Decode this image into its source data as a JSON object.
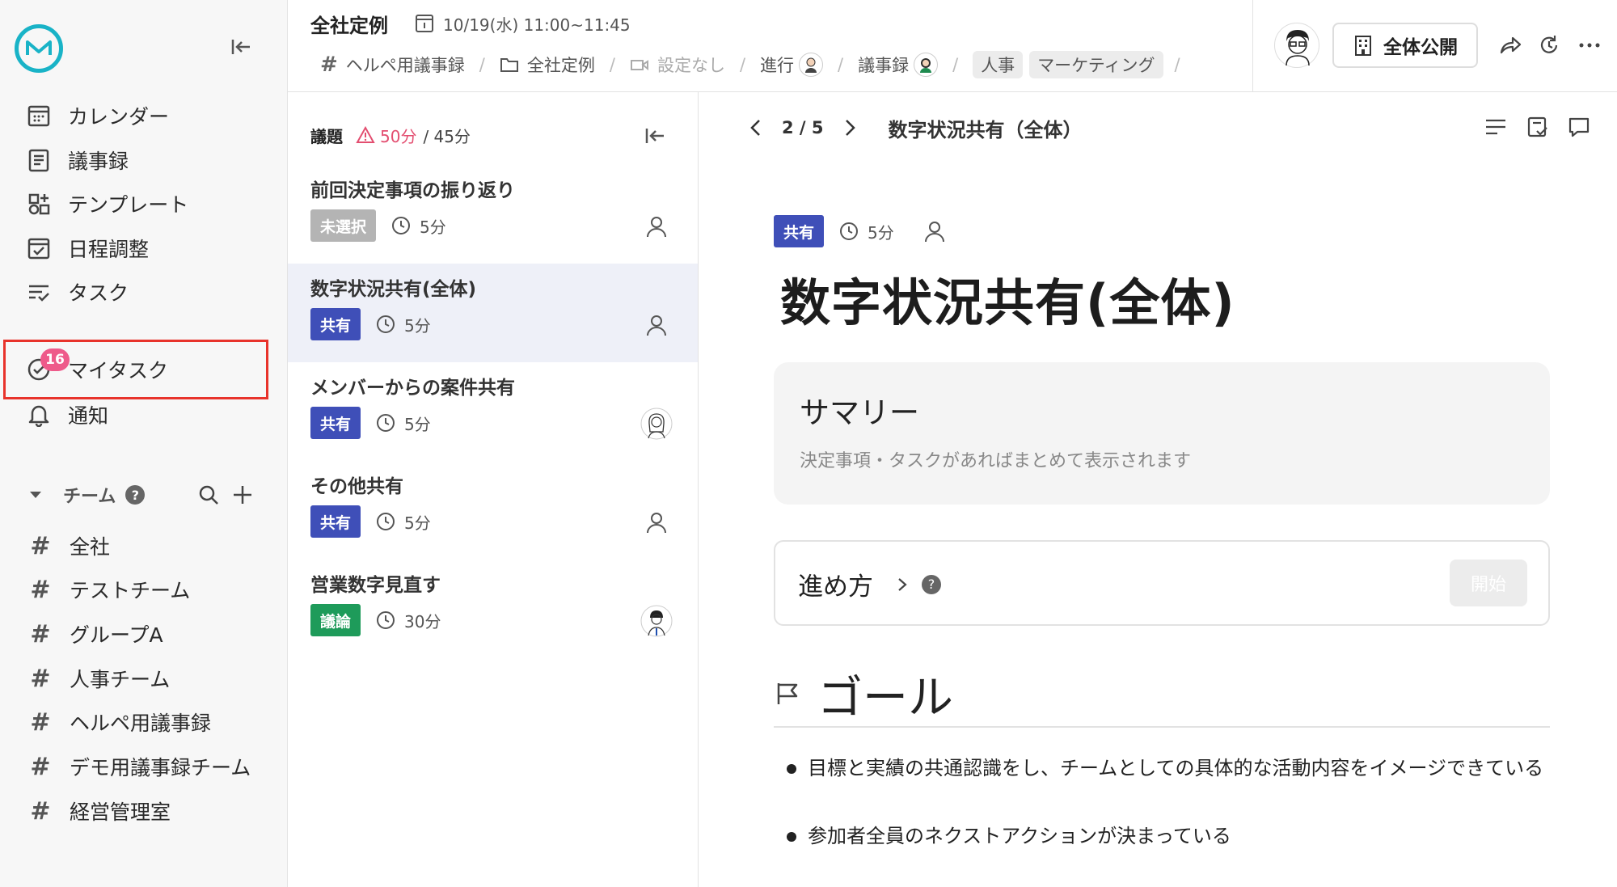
{
  "sidebar": {
    "nav": [
      {
        "label": "カレンダー",
        "icon": "calendar-icon"
      },
      {
        "label": "議事録",
        "icon": "document-icon"
      },
      {
        "label": "テンプレート",
        "icon": "template-icon"
      },
      {
        "label": "日程調整",
        "icon": "schedule-icon"
      },
      {
        "label": "タスク",
        "icon": "task-list-icon"
      },
      {
        "label": "マイタスク",
        "icon": "my-task-icon",
        "badge": "16"
      },
      {
        "label": "通知",
        "icon": "bell-icon"
      }
    ],
    "team_header": "チーム",
    "teams": [
      {
        "label": "全社",
        "locked": false
      },
      {
        "label": "テストチーム",
        "locked": false
      },
      {
        "label": "グループA",
        "locked": true
      },
      {
        "label": "人事チーム",
        "locked": true
      },
      {
        "label": "ヘルペ用議事録",
        "locked": false
      },
      {
        "label": "デモ用議事録チーム",
        "locked": false
      },
      {
        "label": "経営管理室",
        "locked": false
      }
    ]
  },
  "header": {
    "title": "全社定例",
    "datetime": "10/19(水) 11:00~11:45",
    "crumbs": {
      "channel": "ヘルペ用議事録",
      "folder": "全社定例",
      "video": "設定なし",
      "facilitator_label": "進行",
      "minutes_label": "議事録",
      "tags": [
        "人事",
        "マーケティング"
      ]
    },
    "publish_label": "全体公開"
  },
  "agenda": {
    "label": "議題",
    "planned": "50分",
    "total": "/ 45分",
    "items": [
      {
        "title": "前回決定事項の振り返り",
        "tag": "未選択",
        "tag_type": "none",
        "time": "5分",
        "owner": "person"
      },
      {
        "title": "数字状況共有(全体)",
        "tag": "共有",
        "tag_type": "share",
        "time": "5分",
        "owner": "person",
        "active": true
      },
      {
        "title": "メンバーからの案件共有",
        "tag": "共有",
        "tag_type": "share",
        "time": "5分",
        "owner": "avatar-woman"
      },
      {
        "title": "その他共有",
        "tag": "共有",
        "tag_type": "share",
        "time": "5分",
        "owner": "person"
      },
      {
        "title": "営業数字見直す",
        "tag": "議論",
        "tag_type": "discuss",
        "time": "30分",
        "owner": "avatar-man"
      }
    ]
  },
  "main": {
    "page": "2 / 5",
    "doc_title": "数字状況共有（全体）",
    "topic_tag": "共有",
    "topic_time": "5分",
    "topic_title": "数字状況共有(全体)",
    "summary_heading": "サマリー",
    "summary_sub": "決定事項・タスクがあればまとめて表示されます",
    "process_label": "進め方",
    "start_label": "開始",
    "goal_heading": "ゴール",
    "goals": [
      "目標と実績の共通認識をし、チームとしての具体的な活動内容をイメージできている",
      "参加者全員のネクストアクションが決まっている"
    ]
  },
  "colors": {
    "accent_share": "#3f4fb8",
    "accent_discuss": "#1e9b5a",
    "tag_none": "#b4b4b4",
    "badge": "#ee5a8a",
    "warning": "#e34e70",
    "logo": "#19b3c7",
    "highlight": "#e8332b"
  }
}
